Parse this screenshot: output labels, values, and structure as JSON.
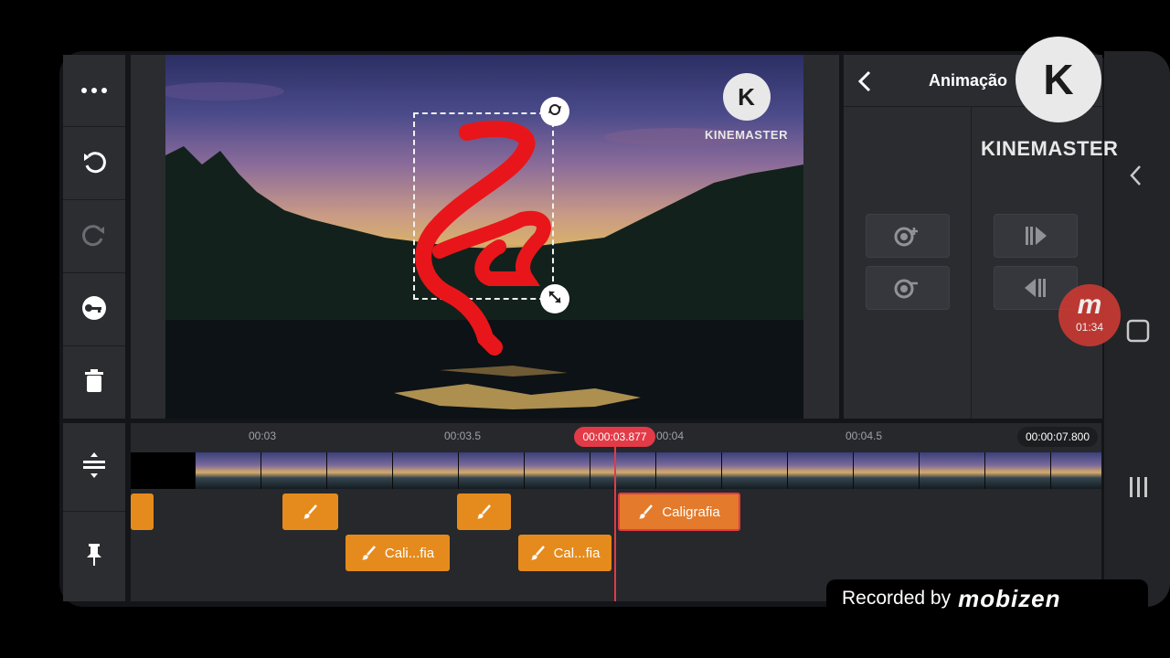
{
  "toolbar": {
    "items": [
      {
        "name": "more-icon"
      },
      {
        "name": "undo-icon"
      },
      {
        "name": "redo-icon"
      },
      {
        "name": "keyframe-icon"
      },
      {
        "name": "delete-icon"
      }
    ],
    "bottom_items": [
      {
        "name": "track-adjust-icon"
      },
      {
        "name": "pin-icon"
      }
    ]
  },
  "preview": {
    "watermark_text": "KINEMASTER",
    "watermark_logo": "K"
  },
  "panel": {
    "title": "Animação",
    "back_icon": "chevron-left-icon"
  },
  "overlay_logo": {
    "letter": "K",
    "text": "KINEMASTER"
  },
  "recorder": {
    "time": "01:34",
    "badge": "m",
    "recorded_by": "Recorded by",
    "brand": "mobizen"
  },
  "timeline": {
    "ticks": [
      "00:03",
      "00:03.5",
      "00:04",
      "00:04.5"
    ],
    "current_time": "00:00:03.877",
    "total_time": "00:00:07.800",
    "clips": [
      {
        "label": ""
      },
      {
        "label": ""
      },
      {
        "label": ""
      },
      {
        "label": "Caligrafia"
      },
      {
        "label": "Cali...fia"
      },
      {
        "label": "Cal...fia"
      }
    ]
  },
  "colors": {
    "accent_red": "#e23b47",
    "clip_orange": "#e58b1d",
    "panel_bg": "#2a2c30"
  }
}
